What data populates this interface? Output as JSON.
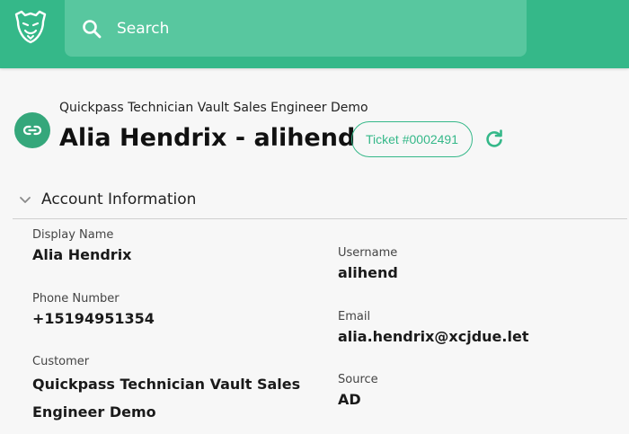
{
  "search": {
    "placeholder": "Search"
  },
  "header": {
    "subtitle": "Quickpass Technician Vault Sales Engineer Demo",
    "title": "Alia Hendrix - alihend",
    "ticket": "Ticket #0002491"
  },
  "section": {
    "title": "Account Information"
  },
  "fields": {
    "display_name": {
      "label": "Display Name",
      "value": "Alia Hendrix"
    },
    "phone_number": {
      "label": "Phone Number",
      "value": "+15194951354"
    },
    "customer": {
      "label": "Customer",
      "value": "Quickpass Technician Vault Sales Engineer Demo"
    },
    "username": {
      "label": "Username",
      "value": "alihend"
    },
    "email": {
      "label": "Email",
      "value": "alia.hendrix@xcjdue.let"
    },
    "source": {
      "label": "Source",
      "value": "AD"
    }
  },
  "icons": {
    "logo": "cheetah-logo-icon",
    "search": "search-icon",
    "link": "link-icon",
    "refresh": "refresh-icon",
    "chevron": "chevron-down-icon"
  },
  "colors": {
    "brand": "#35b889",
    "search_bg": "#58c79f",
    "link_badge": "#35a77b",
    "page_bg": "#f7f7f7"
  }
}
